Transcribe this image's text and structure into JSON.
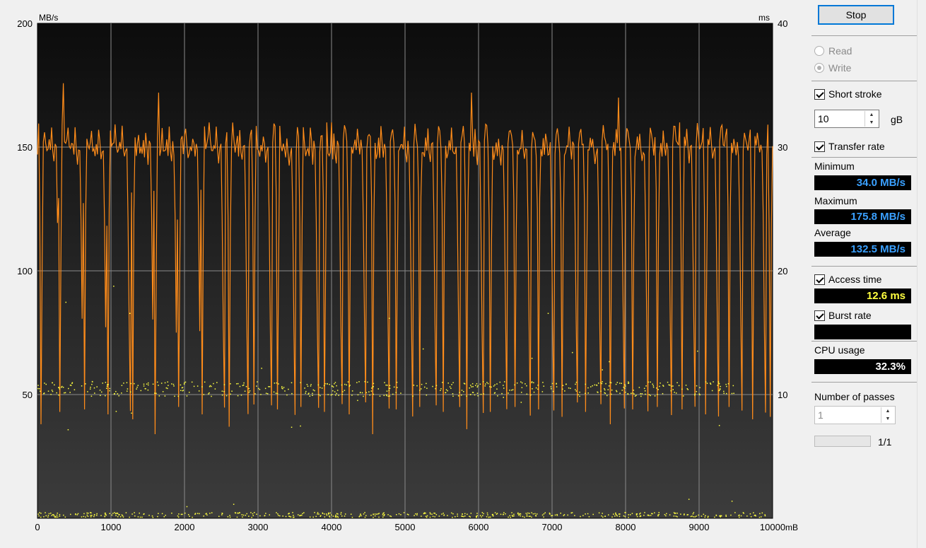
{
  "chart_data": {
    "type": "line",
    "y_left_label": "MB/s",
    "y_right_label": "ms",
    "x_unit_label": "mB",
    "y_left_ticks": [
      50,
      100,
      150,
      200
    ],
    "y_right_ticks": [
      10,
      20,
      30,
      40
    ],
    "x_ticks": [
      "0",
      "1000",
      "2000",
      "3000",
      "4000",
      "5000",
      "6000",
      "7000",
      "8000",
      "9000",
      "10000"
    ],
    "y_left_range": [
      0,
      200
    ],
    "y_right_range": [
      0,
      40
    ],
    "x_range": [
      0,
      10000
    ],
    "grid": true,
    "series": [
      {
        "name": "Transfer rate",
        "color": "#ff8c1a",
        "pattern_mbps": [
          150,
          157,
          156,
          152,
          149,
          152,
          157,
          150,
          147,
          149,
          152,
          148,
          156,
          150,
          145,
          150,
          149,
          122,
          78,
          44
        ],
        "peaks": [
          {
            "x": 350,
            "y": 175.8
          },
          {
            "x": 1650,
            "y": 172
          },
          {
            "x": 4000,
            "y": 160
          },
          {
            "x": 5900,
            "y": 172
          },
          {
            "x": 7900,
            "y": 170
          }
        ],
        "dips": [
          {
            "x": 40,
            "y": 38
          },
          {
            "x": 300,
            "y": 43
          },
          {
            "x": 640,
            "y": 44
          },
          {
            "x": 960,
            "y": 42
          },
          {
            "x": 1290,
            "y": 40
          },
          {
            "x": 1600,
            "y": 34.0
          },
          {
            "x": 1920,
            "y": 45
          },
          {
            "x": 2240,
            "y": 42
          },
          {
            "x": 2600,
            "y": 37
          },
          {
            "x": 2950,
            "y": 46
          },
          {
            "x": 3260,
            "y": 44
          },
          {
            "x": 3590,
            "y": 45
          },
          {
            "x": 3910,
            "y": 43
          },
          {
            "x": 4240,
            "y": 42
          },
          {
            "x": 4560,
            "y": 34
          },
          {
            "x": 4880,
            "y": 44
          },
          {
            "x": 5200,
            "y": 45
          },
          {
            "x": 5520,
            "y": 43
          },
          {
            "x": 5840,
            "y": 36
          },
          {
            "x": 6160,
            "y": 43
          },
          {
            "x": 6490,
            "y": 45
          },
          {
            "x": 6810,
            "y": 44
          },
          {
            "x": 7130,
            "y": 41
          },
          {
            "x": 7460,
            "y": 43
          },
          {
            "x": 7790,
            "y": 38
          },
          {
            "x": 8100,
            "y": 44
          },
          {
            "x": 8430,
            "y": 45
          },
          {
            "x": 8760,
            "y": 44
          },
          {
            "x": 9080,
            "y": 42
          },
          {
            "x": 9400,
            "y": 45
          },
          {
            "x": 9730,
            "y": 40
          },
          {
            "x": 9960,
            "y": 41
          }
        ]
      },
      {
        "name": "Access time",
        "color": "#ffff40",
        "kind": "scatter",
        "cluster_ms": [
          9.9,
          10.4,
          11.1
        ],
        "low_ms": [
          0.0,
          0.4
        ]
      }
    ]
  },
  "panel": {
    "stop_label": "Stop",
    "radio_read": "Read",
    "radio_write": "Write",
    "short_stroke_label": "Short stroke",
    "short_stroke_value": "10",
    "short_stroke_unit": "gB",
    "transfer_rate_label": "Transfer rate",
    "minimum_label": "Minimum",
    "minimum_value": "34.0 MB/s",
    "maximum_label": "Maximum",
    "maximum_value": "175.8 MB/s",
    "average_label": "Average",
    "average_value": "132.5 MB/s",
    "access_time_label": "Access time",
    "access_time_value": "12.6 ms",
    "burst_rate_label": "Burst rate",
    "burst_rate_value": "",
    "cpu_usage_label": "CPU usage",
    "cpu_usage_value": "32.3%",
    "passes_label": "Number of passes",
    "passes_value": "1",
    "progress_text": "1/1",
    "progress_fraction": 0
  }
}
